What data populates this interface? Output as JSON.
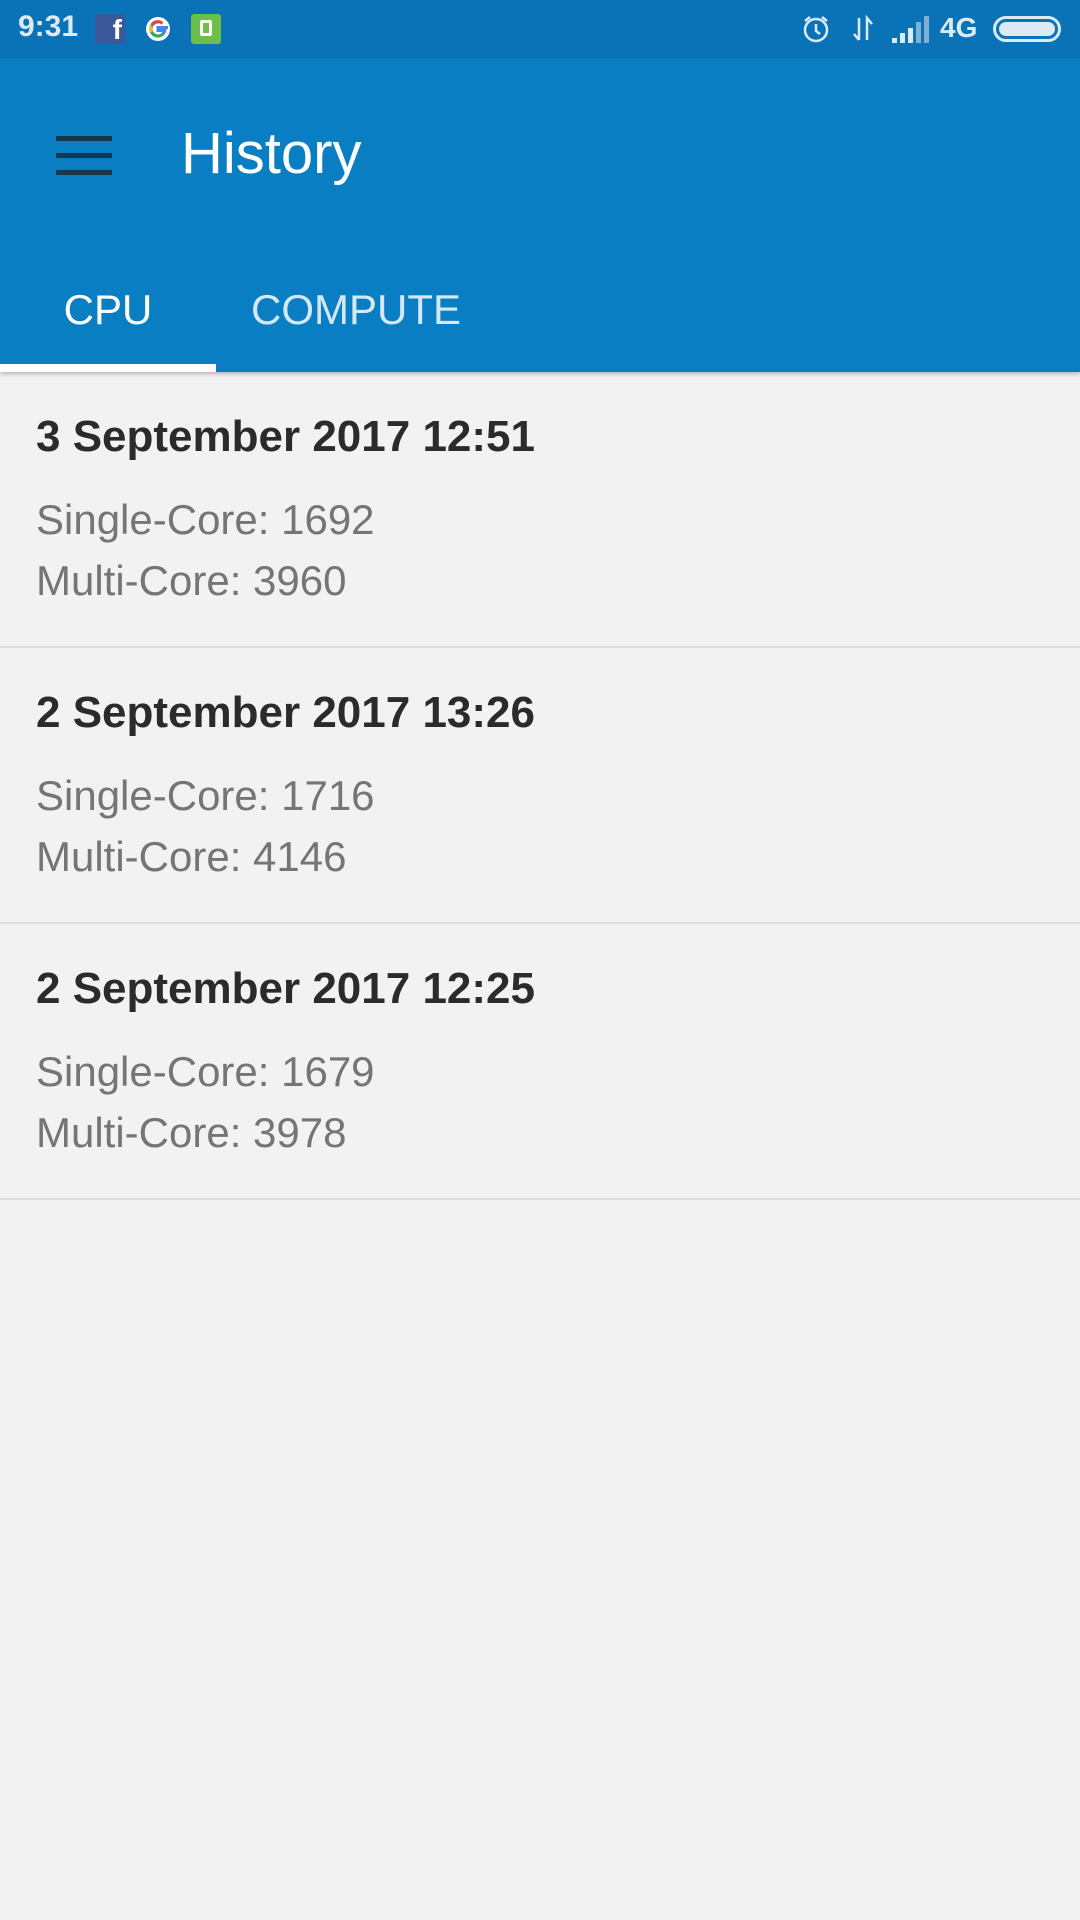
{
  "status_bar": {
    "time": "9:31",
    "network": "4G",
    "icons": [
      "facebook-icon",
      "google-icon",
      "battery-saver-icon",
      "alarm-icon",
      "data-transfer-icon",
      "signal-icon",
      "battery-icon"
    ]
  },
  "app_bar": {
    "title": "History",
    "menu_icon": "hamburger-menu-icon",
    "background_color": "#0a7ec2"
  },
  "tabs": [
    {
      "label": "CPU",
      "active": true
    },
    {
      "label": "COMPUTE",
      "active": false
    }
  ],
  "history": [
    {
      "date": "3 September 2017 12:51",
      "single": "Single-Core: 1692",
      "multi": "Multi-Core: 3960"
    },
    {
      "date": "2 September 2017 13:26",
      "single": "Single-Core: 1716",
      "multi": "Multi-Core: 4146"
    },
    {
      "date": "2 September 2017 12:25",
      "single": "Single-Core: 1679",
      "multi": "Multi-Core: 3978"
    }
  ]
}
